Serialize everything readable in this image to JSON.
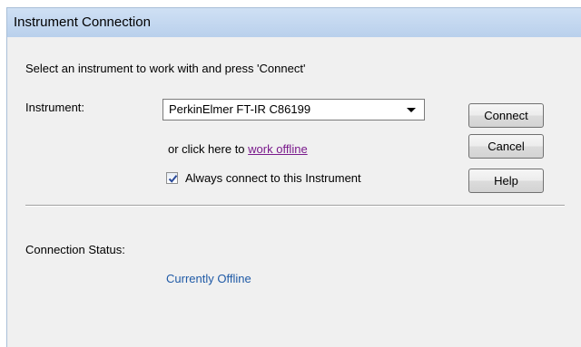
{
  "window": {
    "title": "Instrument Connection"
  },
  "dialog": {
    "instruction": "Select an instrument to work with and press 'Connect'",
    "instrument_label": "Instrument:",
    "instrument_selected": "PerkinElmer FT-IR C86199",
    "offline_prefix": "or click here to ",
    "offline_link": "work offline",
    "always_connect_label": "Always connect to this Instrument",
    "always_connect_checked": true,
    "status_label": "Connection Status:",
    "status_value": "Currently Offline"
  },
  "buttons": {
    "connect": "Connect",
    "cancel": "Cancel",
    "help": "Help"
  },
  "colors": {
    "titlebar": "#c4d8f0",
    "link": "#7a1a8c",
    "status": "#1f5aa6"
  }
}
